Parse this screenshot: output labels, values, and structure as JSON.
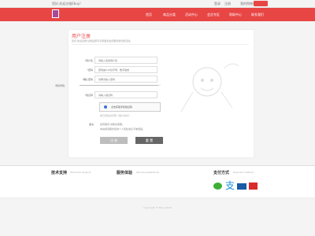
{
  "topbar": {
    "left": "您好,欢迎光临Ebuy!",
    "login": "登录",
    "register": "注册",
    "cart": "我的购物车",
    "hotline": "400-888"
  },
  "nav": {
    "items": [
      "首页",
      "商品分类",
      "活动中心",
      "会员专区",
      "帮助中心",
      "联系我们"
    ],
    "active_color": "#e84545"
  },
  "form": {
    "title": "用户注册",
    "subtitle": "您好,欢迎注册!注册后即可享受更多会员服务和优惠活动。",
    "fields": [
      {
        "label": "*用户名",
        "placeholder": "请输入您的用户名"
      },
      {
        "label": "*密码",
        "placeholder": "密码由6-16位字母、数字组成"
      },
      {
        "label": "*确认密码",
        "placeholder": "请再次输入密码"
      },
      {
        "label": "手机号码",
        "placeholder": "请输入手机号码"
      },
      {
        "label": "*验证码",
        "placeholder": "请输入验证码"
      }
    ],
    "captcha": "点击获取手机验证码",
    "notice": "我已阅读并同意《用户协议》",
    "remark_label": "备注:",
    "remark_line1": "如有疑问,请联系客服。",
    "remark_line2": "本站承诺保护您的个人隐私信息不被泄露。",
    "submit": "注 册",
    "reset": "重 置"
  },
  "footer": {
    "col1_title": "技术支持",
    "col1_sub": "Technical support",
    "col2_title": "服务体验",
    "col2_sub": "Service experience",
    "col3_title": "支付方式",
    "col3_sub": "Payment method",
    "copyright": "Copyright © Ebuy 2016"
  }
}
